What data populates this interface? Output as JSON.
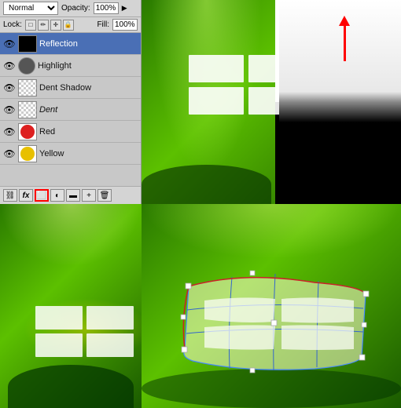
{
  "panel": {
    "blend_mode": "Normal",
    "opacity_label": "Opacity:",
    "opacity_value": "100%",
    "lock_label": "Lock:",
    "fill_label": "Fill:",
    "fill_value": "100%",
    "layers": [
      {
        "id": 1,
        "name": "Reflection",
        "thumb_type": "black",
        "selected": true,
        "italic": false,
        "visible": true
      },
      {
        "id": 2,
        "name": "Highlight",
        "thumb_type": "circle_dark",
        "selected": false,
        "italic": false,
        "visible": true
      },
      {
        "id": 3,
        "name": "Dent Shadow",
        "thumb_type": "checker",
        "selected": false,
        "italic": false,
        "visible": true
      },
      {
        "id": 4,
        "name": "Dent",
        "thumb_type": "checker",
        "selected": false,
        "italic": true,
        "visible": true
      },
      {
        "id": 5,
        "name": "Red",
        "thumb_type": "red_circle",
        "selected": false,
        "italic": false,
        "visible": true
      },
      {
        "id": 6,
        "name": "Yellow",
        "thumb_type": "yellow_circle",
        "selected": false,
        "italic": false,
        "visible": true
      }
    ],
    "bottom_icons": [
      "link",
      "fx",
      "mask",
      "adjustment",
      "folder",
      "new",
      "delete"
    ]
  },
  "canvases": {
    "top_right": {
      "description": "Green gradient with white rectangles and red arrow"
    },
    "bottom_left": {
      "description": "Green gradient with white highlight reflection"
    },
    "bottom_right": {
      "description": "Green gradient with warp transform overlay"
    }
  }
}
